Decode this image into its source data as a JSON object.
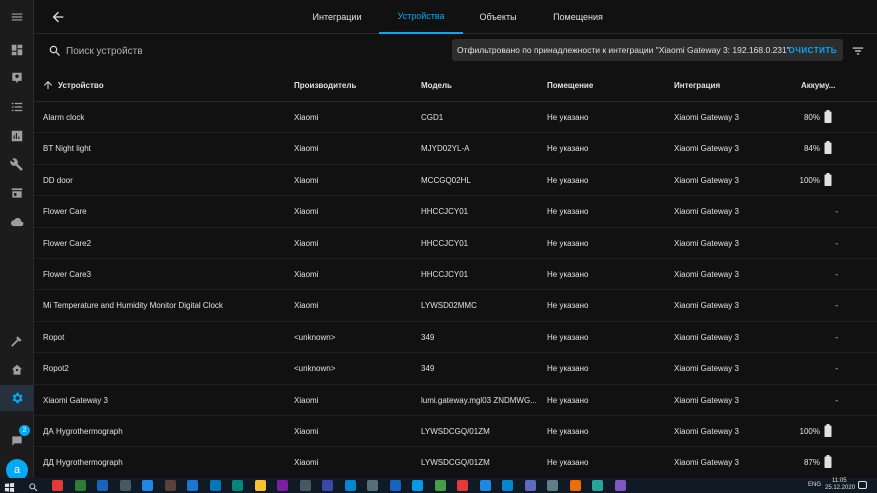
{
  "topbar": {
    "tabs": [
      "Интеграции",
      "Устройства",
      "Объекты",
      "Помещения"
    ],
    "active_tab": "Устройства"
  },
  "search": {
    "placeholder": "Поиск устройств"
  },
  "filter": {
    "text": "Отфильтровано по принадлежности к интеграции \"Xiaomi Gateway 3: 192.168.0.231\"",
    "clear_label": "ОЧИСТИТЬ"
  },
  "sidebar": {
    "icons": [
      "overview-icon",
      "map-icon",
      "logbook-icon",
      "history-icon",
      "wrench-icon",
      "store-icon",
      "cloud-icon"
    ],
    "bottom_icons": [
      "hammer-icon",
      "home-config-icon",
      "gear-icon"
    ],
    "notification_count": "2",
    "avatar_letter": "a"
  },
  "table": {
    "headers": {
      "name": "Устройство",
      "manufacturer": "Производитель",
      "model": "Модель",
      "area": "Помещение",
      "integration": "Интеграция",
      "battery": "Аккуму..."
    },
    "rows": [
      {
        "name": "Alarm clock",
        "manufacturer": "Xiaomi",
        "model": "CGD1",
        "area": "Не указано",
        "integration": "Xiaomi Gateway 3",
        "battery": "80%",
        "has_battery": true
      },
      {
        "name": "BT Night light",
        "manufacturer": "Xiaomi",
        "model": "MJYD02YL-A",
        "area": "Не указано",
        "integration": "Xiaomi Gateway 3",
        "battery": "84%",
        "has_battery": true
      },
      {
        "name": "DD door",
        "manufacturer": "Xiaomi",
        "model": "MCCGQ02HL",
        "area": "Не указано",
        "integration": "Xiaomi Gateway 3",
        "battery": "100%",
        "has_battery": true
      },
      {
        "name": "Flower Care",
        "manufacturer": "Xiaomi",
        "model": "HHCCJCY01",
        "area": "Не указано",
        "integration": "Xiaomi Gateway 3",
        "battery": "-",
        "has_battery": false
      },
      {
        "name": "Flower Care2",
        "manufacturer": "Xiaomi",
        "model": "HHCCJCY01",
        "area": "Не указано",
        "integration": "Xiaomi Gateway 3",
        "battery": "-",
        "has_battery": false
      },
      {
        "name": "Flower Care3",
        "manufacturer": "Xiaomi",
        "model": "HHCCJCY01",
        "area": "Не указано",
        "integration": "Xiaomi Gateway 3",
        "battery": "-",
        "has_battery": false
      },
      {
        "name": "Mi Temperature and Humidity Monitor Digital Clock",
        "manufacturer": "Xiaomi",
        "model": "LYWSD02MMC",
        "area": "Не указано",
        "integration": "Xiaomi Gateway 3",
        "battery": "-",
        "has_battery": false
      },
      {
        "name": "Ropot",
        "manufacturer": "<unknown>",
        "model": "349",
        "area": "Не указано",
        "integration": "Xiaomi Gateway 3",
        "battery": "-",
        "has_battery": false
      },
      {
        "name": "Ropot2",
        "manufacturer": "<unknown>",
        "model": "349",
        "area": "Не указано",
        "integration": "Xiaomi Gateway 3",
        "battery": "-",
        "has_battery": false
      },
      {
        "name": "Xiaomi Gateway 3",
        "manufacturer": "Xiaomi",
        "model": "lumi.gateway.mgl03 ZNDMWG...",
        "area": "Не указано",
        "integration": "Xiaomi Gateway 3",
        "battery": "-",
        "has_battery": false
      },
      {
        "name": "ДА Hygrothermograph",
        "manufacturer": "Xiaomi",
        "model": "LYWSDCGQ/01ZM",
        "area": "Не указано",
        "integration": "Xiaomi Gateway 3",
        "battery": "100%",
        "has_battery": true
      },
      {
        "name": "ДД Hygrothermograph",
        "manufacturer": "Xiaomi",
        "model": "LYWSDCGQ/01ZM",
        "area": "Не указано",
        "integration": "Xiaomi Gateway 3",
        "battery": "87%",
        "has_battery": true
      }
    ]
  },
  "taskbar": {
    "language": "ENG",
    "time": "11:05",
    "date": "25.12.2020"
  },
  "colors": {
    "accent": "#03a9f4",
    "background": "#111111",
    "sidebar": "#1c1c1c",
    "chip": "#2d2d2d"
  }
}
